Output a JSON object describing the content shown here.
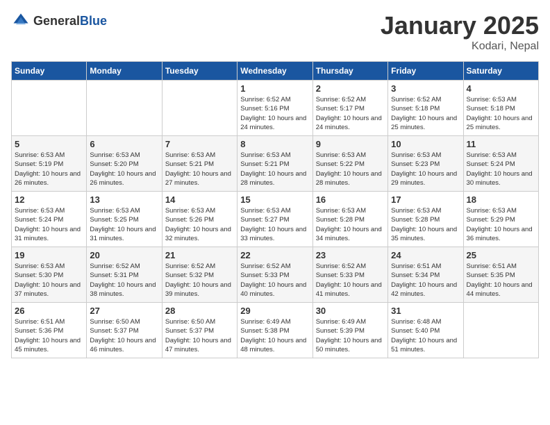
{
  "header": {
    "logo_general": "General",
    "logo_blue": "Blue",
    "month": "January 2025",
    "location": "Kodari, Nepal"
  },
  "days_of_week": [
    "Sunday",
    "Monday",
    "Tuesday",
    "Wednesday",
    "Thursday",
    "Friday",
    "Saturday"
  ],
  "weeks": [
    [
      {
        "day": "",
        "sunrise": "",
        "sunset": "",
        "daylight": ""
      },
      {
        "day": "",
        "sunrise": "",
        "sunset": "",
        "daylight": ""
      },
      {
        "day": "",
        "sunrise": "",
        "sunset": "",
        "daylight": ""
      },
      {
        "day": "1",
        "sunrise": "Sunrise: 6:52 AM",
        "sunset": "Sunset: 5:16 PM",
        "daylight": "Daylight: 10 hours and 24 minutes."
      },
      {
        "day": "2",
        "sunrise": "Sunrise: 6:52 AM",
        "sunset": "Sunset: 5:17 PM",
        "daylight": "Daylight: 10 hours and 24 minutes."
      },
      {
        "day": "3",
        "sunrise": "Sunrise: 6:52 AM",
        "sunset": "Sunset: 5:18 PM",
        "daylight": "Daylight: 10 hours and 25 minutes."
      },
      {
        "day": "4",
        "sunrise": "Sunrise: 6:53 AM",
        "sunset": "Sunset: 5:18 PM",
        "daylight": "Daylight: 10 hours and 25 minutes."
      }
    ],
    [
      {
        "day": "5",
        "sunrise": "Sunrise: 6:53 AM",
        "sunset": "Sunset: 5:19 PM",
        "daylight": "Daylight: 10 hours and 26 minutes."
      },
      {
        "day": "6",
        "sunrise": "Sunrise: 6:53 AM",
        "sunset": "Sunset: 5:20 PM",
        "daylight": "Daylight: 10 hours and 26 minutes."
      },
      {
        "day": "7",
        "sunrise": "Sunrise: 6:53 AM",
        "sunset": "Sunset: 5:21 PM",
        "daylight": "Daylight: 10 hours and 27 minutes."
      },
      {
        "day": "8",
        "sunrise": "Sunrise: 6:53 AM",
        "sunset": "Sunset: 5:21 PM",
        "daylight": "Daylight: 10 hours and 28 minutes."
      },
      {
        "day": "9",
        "sunrise": "Sunrise: 6:53 AM",
        "sunset": "Sunset: 5:22 PM",
        "daylight": "Daylight: 10 hours and 28 minutes."
      },
      {
        "day": "10",
        "sunrise": "Sunrise: 6:53 AM",
        "sunset": "Sunset: 5:23 PM",
        "daylight": "Daylight: 10 hours and 29 minutes."
      },
      {
        "day": "11",
        "sunrise": "Sunrise: 6:53 AM",
        "sunset": "Sunset: 5:24 PM",
        "daylight": "Daylight: 10 hours and 30 minutes."
      }
    ],
    [
      {
        "day": "12",
        "sunrise": "Sunrise: 6:53 AM",
        "sunset": "Sunset: 5:24 PM",
        "daylight": "Daylight: 10 hours and 31 minutes."
      },
      {
        "day": "13",
        "sunrise": "Sunrise: 6:53 AM",
        "sunset": "Sunset: 5:25 PM",
        "daylight": "Daylight: 10 hours and 31 minutes."
      },
      {
        "day": "14",
        "sunrise": "Sunrise: 6:53 AM",
        "sunset": "Sunset: 5:26 PM",
        "daylight": "Daylight: 10 hours and 32 minutes."
      },
      {
        "day": "15",
        "sunrise": "Sunrise: 6:53 AM",
        "sunset": "Sunset: 5:27 PM",
        "daylight": "Daylight: 10 hours and 33 minutes."
      },
      {
        "day": "16",
        "sunrise": "Sunrise: 6:53 AM",
        "sunset": "Sunset: 5:28 PM",
        "daylight": "Daylight: 10 hours and 34 minutes."
      },
      {
        "day": "17",
        "sunrise": "Sunrise: 6:53 AM",
        "sunset": "Sunset: 5:28 PM",
        "daylight": "Daylight: 10 hours and 35 minutes."
      },
      {
        "day": "18",
        "sunrise": "Sunrise: 6:53 AM",
        "sunset": "Sunset: 5:29 PM",
        "daylight": "Daylight: 10 hours and 36 minutes."
      }
    ],
    [
      {
        "day": "19",
        "sunrise": "Sunrise: 6:53 AM",
        "sunset": "Sunset: 5:30 PM",
        "daylight": "Daylight: 10 hours and 37 minutes."
      },
      {
        "day": "20",
        "sunrise": "Sunrise: 6:52 AM",
        "sunset": "Sunset: 5:31 PM",
        "daylight": "Daylight: 10 hours and 38 minutes."
      },
      {
        "day": "21",
        "sunrise": "Sunrise: 6:52 AM",
        "sunset": "Sunset: 5:32 PM",
        "daylight": "Daylight: 10 hours and 39 minutes."
      },
      {
        "day": "22",
        "sunrise": "Sunrise: 6:52 AM",
        "sunset": "Sunset: 5:33 PM",
        "daylight": "Daylight: 10 hours and 40 minutes."
      },
      {
        "day": "23",
        "sunrise": "Sunrise: 6:52 AM",
        "sunset": "Sunset: 5:33 PM",
        "daylight": "Daylight: 10 hours and 41 minutes."
      },
      {
        "day": "24",
        "sunrise": "Sunrise: 6:51 AM",
        "sunset": "Sunset: 5:34 PM",
        "daylight": "Daylight: 10 hours and 42 minutes."
      },
      {
        "day": "25",
        "sunrise": "Sunrise: 6:51 AM",
        "sunset": "Sunset: 5:35 PM",
        "daylight": "Daylight: 10 hours and 44 minutes."
      }
    ],
    [
      {
        "day": "26",
        "sunrise": "Sunrise: 6:51 AM",
        "sunset": "Sunset: 5:36 PM",
        "daylight": "Daylight: 10 hours and 45 minutes."
      },
      {
        "day": "27",
        "sunrise": "Sunrise: 6:50 AM",
        "sunset": "Sunset: 5:37 PM",
        "daylight": "Daylight: 10 hours and 46 minutes."
      },
      {
        "day": "28",
        "sunrise": "Sunrise: 6:50 AM",
        "sunset": "Sunset: 5:37 PM",
        "daylight": "Daylight: 10 hours and 47 minutes."
      },
      {
        "day": "29",
        "sunrise": "Sunrise: 6:49 AM",
        "sunset": "Sunset: 5:38 PM",
        "daylight": "Daylight: 10 hours and 48 minutes."
      },
      {
        "day": "30",
        "sunrise": "Sunrise: 6:49 AM",
        "sunset": "Sunset: 5:39 PM",
        "daylight": "Daylight: 10 hours and 50 minutes."
      },
      {
        "day": "31",
        "sunrise": "Sunrise: 6:48 AM",
        "sunset": "Sunset: 5:40 PM",
        "daylight": "Daylight: 10 hours and 51 minutes."
      },
      {
        "day": "",
        "sunrise": "",
        "sunset": "",
        "daylight": ""
      }
    ]
  ]
}
